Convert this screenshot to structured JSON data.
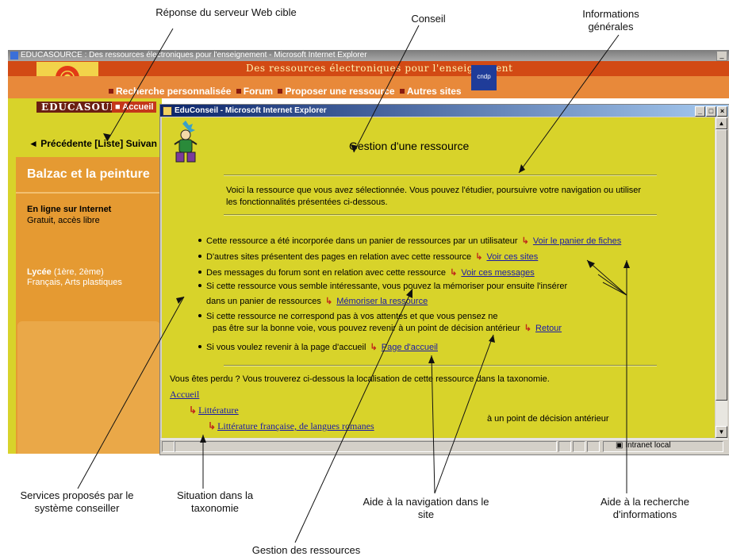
{
  "callouts": {
    "server_response": "Réponse du serveur Web cible",
    "advice": "Conseil",
    "general_info": "Informations générales",
    "services": "Services proposés par le système conseiller",
    "taxonomy_position": "Situation dans la taxonomie",
    "navigation_help": "Aide à la navigation dans le site",
    "search_help": "Aide à la recherche d'informations",
    "resource_management": "Gestion des ressources"
  },
  "outer_window": {
    "title": "EDUCASOURCE : Des ressources électroniques pour l'enseignement - Microsoft Internet Explorer",
    "banner": "Des ressources électroniques pour l'enseignement",
    "nav_items": [
      "Recherche personnalisée",
      "Forum",
      "Proposer une ressource",
      "Autres sites"
    ],
    "brand": "EDUCASOURCE",
    "home_tab": "Accueil",
    "cndp_label": "cndp",
    "prev_next": "Précédente [Liste] Suivan",
    "resource_title": "Balzac et la peinture",
    "availability_heading": "En ligne sur Internet",
    "availability_detail": "Gratuit, accès libre",
    "level_heading": "Lycée",
    "level_detail": "(1ère, 2ème)",
    "subjects": "Français, Arts plastiques"
  },
  "inner_window": {
    "title": "EduConseil - Microsoft Internet Explorer",
    "heading": "Gestion d'une ressource",
    "intro": "Voici la ressource que vous avez sélectionnée. Vous pouvez l'étudier, poursuivre votre navigation ou utiliser les fonctionnalités présentées ci-dessous.",
    "arrow_glyph": "↳",
    "bullets": [
      {
        "text": "Cette ressource a été incorporée dans un panier de ressources par un utilisateur",
        "link": "Voir le panier de fiches"
      },
      {
        "text": "D'autres sites présentent des pages en relation avec cette ressource",
        "link": "Voir ces sites"
      },
      {
        "text": "Des messages du forum sont en relation avec cette ressource",
        "link": "Voir ces messages"
      },
      {
        "text": "Si cette ressource vous semble intéressante, vous pouvez la mémoriser pour ensuite l'insérer",
        "text2": "dans un panier de ressources",
        "link": "Mémoriser la ressource"
      },
      {
        "text": "Si cette ressource ne correspond pas à vos attentes et que vous pensez ne",
        "text2": "pas être sur la bonne voie, vous pouvez revenir à un point de décision antérieur",
        "link": "Retour"
      },
      {
        "text": "Si vous voulez revenir à la page d'accueil",
        "link": "Page d'accueil"
      }
    ],
    "lost_text": "Vous êtes perdu ? Vous trouverez ci-dessous la localisation de cette ressource dans la taxonomie.",
    "taxonomy": [
      "Accueil",
      "Littérature",
      "Littérature française, de langues romanes"
    ],
    "decision_note": "à un point de décision antérieur",
    "status_zone": "Intranet local"
  }
}
